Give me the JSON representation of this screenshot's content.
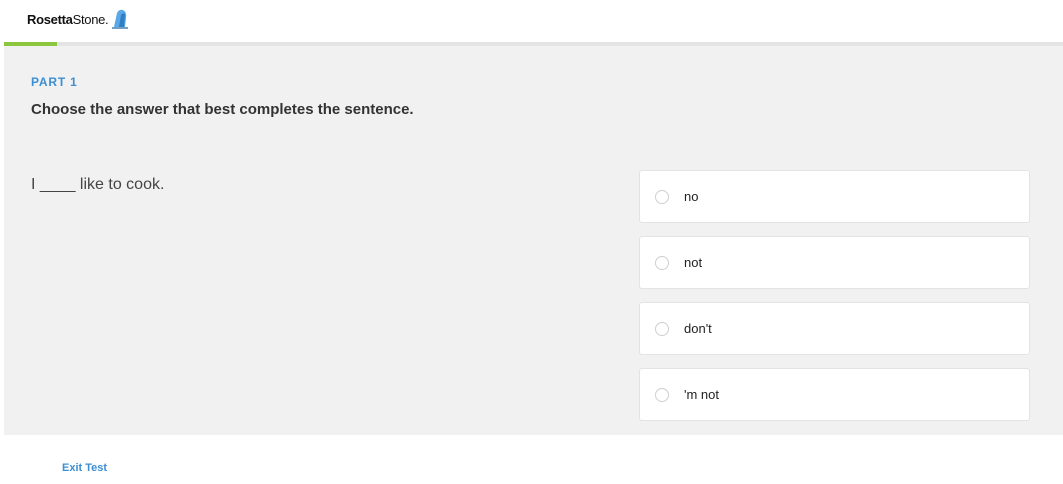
{
  "header": {
    "logo_brand": "Rosetta",
    "logo_rest": "Stone."
  },
  "progress": {
    "fraction": 0.05
  },
  "question": {
    "part": "PART 1",
    "instruction": "Choose the answer that best completes the sentence.",
    "sentence": "I ____ like to cook."
  },
  "choices": [
    {
      "label": "no"
    },
    {
      "label": "not"
    },
    {
      "label": "don't"
    },
    {
      "label": "'m not"
    }
  ],
  "footer": {
    "exit_label": "Exit Test"
  },
  "colors": {
    "accent": "#3c8fd4",
    "progress": "#8cc63f",
    "panel_bg": "#f1f1f1"
  }
}
